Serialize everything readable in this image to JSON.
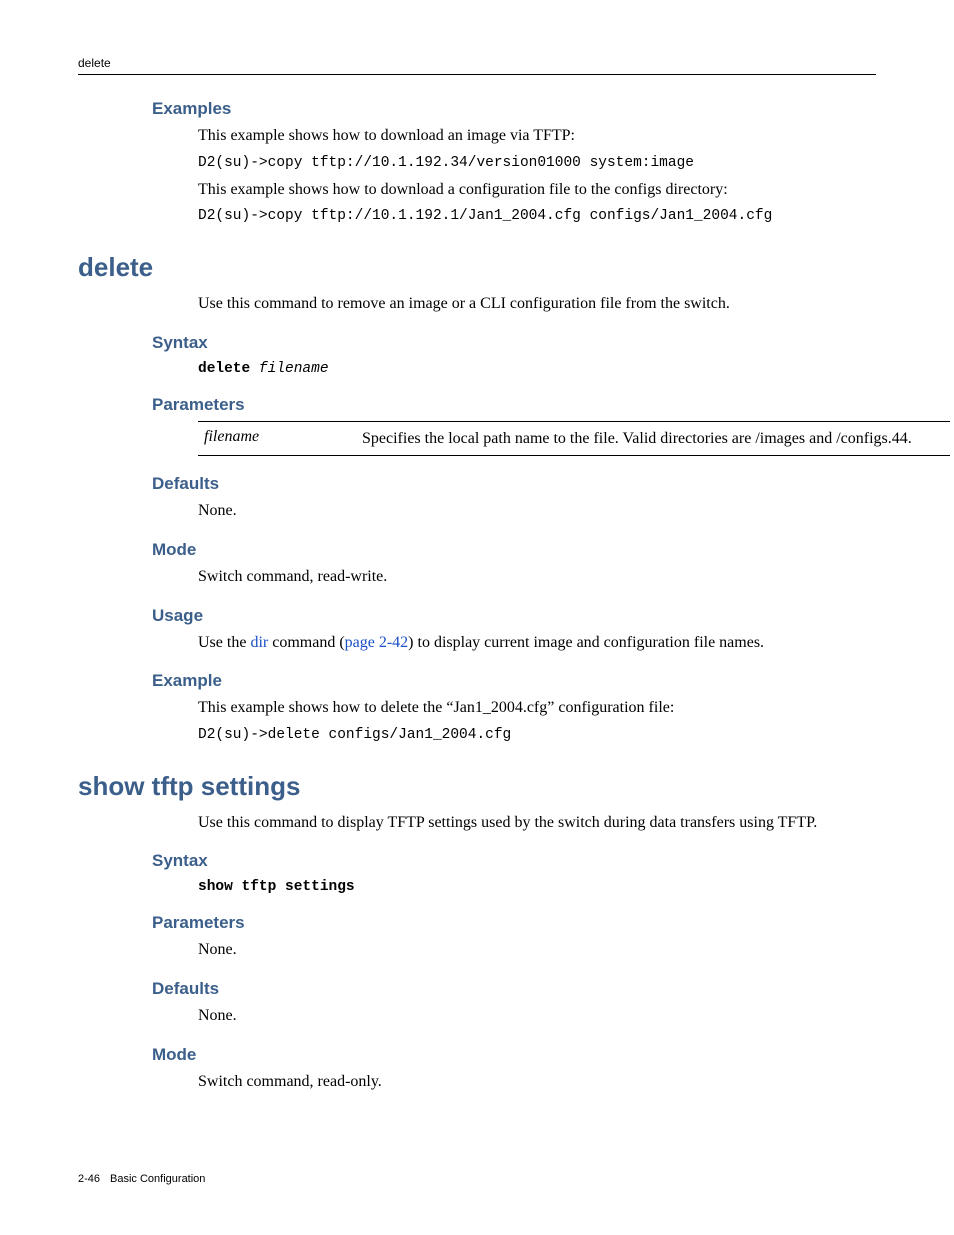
{
  "runningHead": "delete",
  "examplesPrev": {
    "heading": "Examples",
    "line1_body": "This example shows how to download an image via TFTP:",
    "line1_code": "D2(su)->copy tftp://10.1.192.34/version01000 system:image",
    "line2_body": "This example shows how to download a configuration file to the configs directory:",
    "line2_code": "D2(su)->copy tftp://10.1.192.1/Jan1_2004.cfg configs/Jan1_2004.cfg"
  },
  "delete": {
    "title": "delete",
    "intro": "Use this command to remove an image or a CLI configuration file from the switch.",
    "syntax_heading": "Syntax",
    "syntax_cmd": "delete",
    "syntax_arg": "filename",
    "parameters_heading": "Parameters",
    "param_name": "filename",
    "param_desc": "Specifies the local path name to the file. Valid directories are /images and /configs.44.",
    "defaults_heading": "Defaults",
    "defaults_body": "None.",
    "mode_heading": "Mode",
    "mode_body": "Switch command, read-write.",
    "usage_heading": "Usage",
    "usage_prefix": "Use the ",
    "usage_link1": "dir",
    "usage_mid": " command (",
    "usage_link2": "page 2-42",
    "usage_suffix": ") to display current image and configuration file names.",
    "example_heading": "Example",
    "example_body": "This example shows how to delete the “Jan1_2004.cfg” configuration file:",
    "example_code": "D2(su)->delete configs/Jan1_2004.cfg"
  },
  "showTftp": {
    "title": "show tftp settings",
    "intro": "Use this command to display TFTP settings used by the switch during data transfers using TFTP.",
    "syntax_heading": "Syntax",
    "syntax_cmd": "show tftp settings",
    "parameters_heading": "Parameters",
    "parameters_body": "None.",
    "defaults_heading": "Defaults",
    "defaults_body": "None.",
    "mode_heading": "Mode",
    "mode_body": "Switch command, read-only."
  },
  "footer": {
    "pageno": "2-46",
    "section": "Basic Configuration"
  }
}
